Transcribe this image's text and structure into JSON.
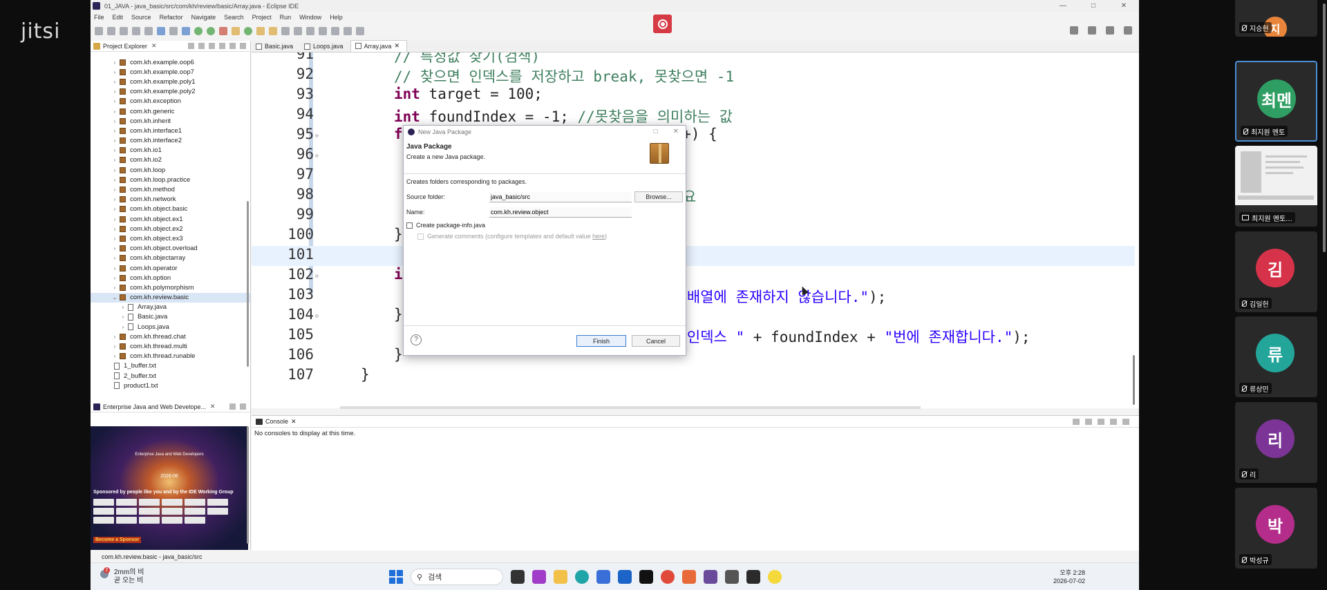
{
  "jitsi": {
    "logo": "jitsi"
  },
  "window": {
    "title": "01_JAVA - java_basic/src/com/kh/review/basic/Array.java - Eclipse IDE",
    "controls": [
      "—",
      "□",
      "✕"
    ]
  },
  "menu": [
    "File",
    "Edit",
    "Source",
    "Refactor",
    "Navigate",
    "Search",
    "Project",
    "Run",
    "Window",
    "Help"
  ],
  "explorer": {
    "tab_label": "Project Explorer",
    "items": [
      {
        "label": "com.kh.example.oop6",
        "kind": "pkg",
        "arrow": "›"
      },
      {
        "label": "com.kh.example.oop7",
        "kind": "pkg",
        "arrow": "›"
      },
      {
        "label": "com.kh.example.poly1",
        "kind": "pkg",
        "arrow": "›"
      },
      {
        "label": "com.kh.example.poly2",
        "kind": "pkg",
        "arrow": "›"
      },
      {
        "label": "com.kh.exception",
        "kind": "pkg",
        "arrow": "›"
      },
      {
        "label": "com.kh.generic",
        "kind": "pkg",
        "arrow": "›"
      },
      {
        "label": "com.kh.inherit",
        "kind": "pkg",
        "arrow": "›"
      },
      {
        "label": "com.kh.interface1",
        "kind": "pkg",
        "arrow": "›"
      },
      {
        "label": "com.kh.interface2",
        "kind": "pkg",
        "arrow": "›"
      },
      {
        "label": "com.kh.io1",
        "kind": "pkg",
        "arrow": "›"
      },
      {
        "label": "com.kh.io2",
        "kind": "pkg",
        "arrow": "›"
      },
      {
        "label": "com.kh.loop",
        "kind": "pkg",
        "arrow": "›"
      },
      {
        "label": "com.kh.loop.practice",
        "kind": "pkg",
        "arrow": "›"
      },
      {
        "label": "com.kh.method",
        "kind": "pkg",
        "arrow": "›"
      },
      {
        "label": "com.kh.network",
        "kind": "pkg",
        "arrow": "›"
      },
      {
        "label": "com.kh.object.basic",
        "kind": "pkg",
        "arrow": "›"
      },
      {
        "label": "com.kh.object.ex1",
        "kind": "pkg",
        "arrow": "›"
      },
      {
        "label": "com.kh.object.ex2",
        "kind": "pkg",
        "arrow": "›"
      },
      {
        "label": "com.kh.object.ex3",
        "kind": "pkg",
        "arrow": "›"
      },
      {
        "label": "com.kh.object.overload",
        "kind": "pkg",
        "arrow": "›"
      },
      {
        "label": "com.kh.objectarray",
        "kind": "pkg",
        "arrow": "›"
      },
      {
        "label": "com.kh.operator",
        "kind": "pkg",
        "arrow": "›"
      },
      {
        "label": "com.kh.option",
        "kind": "pkg",
        "arrow": "›"
      },
      {
        "label": "com.kh.polymorphism",
        "kind": "pkg",
        "arrow": "›"
      },
      {
        "label": "com.kh.review.basic",
        "kind": "pkg",
        "arrow": "⌄",
        "selected": true
      },
      {
        "label": "Array.java",
        "kind": "file",
        "arrow": "›",
        "indent": 1
      },
      {
        "label": "Basic.java",
        "kind": "file",
        "arrow": "›",
        "indent": 1
      },
      {
        "label": "Loops.java",
        "kind": "file",
        "arrow": "›",
        "indent": 1
      },
      {
        "label": "com.kh.thread.chat",
        "kind": "pkg",
        "arrow": "›"
      },
      {
        "label": "com.kh.thread.multi",
        "kind": "pkg",
        "arrow": "›"
      },
      {
        "label": "com.kh.thread.runable",
        "kind": "pkg",
        "arrow": "›"
      },
      {
        "label": "1_buffer.txt",
        "kind": "file",
        "arrow": "",
        "top": true
      },
      {
        "label": "2_buffer.txt",
        "kind": "file",
        "arrow": "",
        "top": true
      },
      {
        "label": "product1.txt",
        "kind": "file",
        "arrow": "",
        "top": true
      }
    ]
  },
  "enterprise": {
    "tab_label": "Enterprise Java and Web Develope...",
    "banner_title": "Enterprise Java and Web Developers",
    "banner_year": "2026-06",
    "sponsored": "Sponsored by people like you and by the IDE Working Group",
    "become": "Become a Sponsor"
  },
  "editor": {
    "tabs": [
      {
        "label": "Basic.java",
        "active": false
      },
      {
        "label": "Loops.java",
        "active": false
      },
      {
        "label": "Array.java",
        "active": true,
        "close": "✕"
      }
    ],
    "lines": [
      {
        "n": "91",
        "fold": "",
        "indent": 96,
        "segs": [
          {
            "c": "cm",
            "t": "// 특정값 찾기(검색)"
          }
        ]
      },
      {
        "n": "92",
        "fold": "",
        "indent": 96,
        "segs": [
          {
            "c": "cm",
            "t": "// 찾으면 인덱스를 저장하고 break, 못찾으면 -1"
          }
        ]
      },
      {
        "n": "93",
        "fold": "",
        "indent": 96,
        "segs": [
          {
            "c": "kw",
            "t": "int"
          },
          {
            "c": "",
            "t": " target = 100;"
          }
        ]
      },
      {
        "n": "94",
        "fold": "",
        "indent": 96,
        "segs": [
          {
            "c": "kw",
            "t": "int"
          },
          {
            "c": "",
            "t": " foundIndex = -1; "
          },
          {
            "c": "cm",
            "t": "//못찾음을 의미하는 값"
          }
        ]
      },
      {
        "n": "95",
        "fold": "⊖",
        "indent": 96,
        "segs": [
          {
            "c": "kw",
            "t": "fo"
          },
          {
            "c": "",
            "t": "                             i++) {"
          }
        ]
      },
      {
        "n": "96",
        "fold": "⊖",
        "indent": 96,
        "segs": []
      },
      {
        "n": "97",
        "fold": "",
        "indent": 96,
        "segs": []
      },
      {
        "n": "98",
        "fold": "",
        "indent": 96,
        "segs": [
          {
            "c": "cm",
            "t": "                              불필요"
          }
        ]
      },
      {
        "n": "99",
        "fold": "",
        "indent": 96,
        "segs": []
      },
      {
        "n": "100",
        "fold": "",
        "indent": 96,
        "segs": [
          {
            "c": "",
            "t": "}"
          }
        ]
      },
      {
        "n": "101",
        "fold": "",
        "indent": 96,
        "segs": [],
        "current": true
      },
      {
        "n": "102",
        "fold": "⊖",
        "indent": 96,
        "segs": [
          {
            "c": "kw",
            "t": "if"
          }
        ]
      },
      {
        "n": "103",
        "fold": "",
        "indent": 96,
        "segs": [
          {
            "c": "",
            "t": "                              "
          },
          {
            "c": "st",
            "t": "\"은 배열에 존재하지 않습니다.\""
          },
          {
            "c": "",
            "t": ");"
          }
        ]
      },
      {
        "n": "104",
        "fold": "⊖",
        "indent": 96,
        "segs": [
          {
            "c": "",
            "t": "} e"
          }
        ]
      },
      {
        "n": "105",
        "fold": "",
        "indent": 96,
        "segs": [
          {
            "c": "",
            "t": "                              "
          },
          {
            "c": "st",
            "t": "\"은 인덱스 \""
          },
          {
            "c": "",
            "t": " + foundIndex + "
          },
          {
            "c": "st",
            "t": "\"번에 존재합니다.\""
          },
          {
            "c": "",
            "t": ");"
          }
        ]
      },
      {
        "n": "106",
        "fold": "",
        "indent": 96,
        "segs": [
          {
            "c": "",
            "t": "}"
          }
        ]
      },
      {
        "n": "107",
        "fold": "",
        "indent": 48,
        "segs": [
          {
            "c": "",
            "t": "}"
          }
        ]
      }
    ]
  },
  "console": {
    "tab_label": "Console",
    "message": "No consoles to display at this time."
  },
  "status": {
    "text": "com.kh.review.basic - java_basic/src"
  },
  "dialog": {
    "window_title": "New Java Package",
    "header_title": "Java Package",
    "header_desc": "Create a new Java package.",
    "desc": "Creates folders corresponding to packages.",
    "source_folder_label": "Source folder:",
    "source_folder_value": "java_basic/src",
    "browse_label": "Browse...",
    "name_label": "Name:",
    "name_value": "com.kh.review.object",
    "create_info_label": "Create package-info.java",
    "generate_label": "Generate comments (configure templates and default value ",
    "generate_link": "here",
    "generate_suffix": ")",
    "help_label": "?",
    "finish_label": "Finish",
    "cancel_label": "Cancel"
  },
  "taskbar": {
    "weather_badge": "2",
    "weather_line1": "2mm의 비",
    "weather_line2": "곧 오는 비",
    "search_label": "검색",
    "time": "오후 2:28",
    "date": "2026-07-02"
  },
  "participants": [
    {
      "initial": "지",
      "name": "지승헌",
      "color": "#e8853a",
      "partial": true
    },
    {
      "initial": "최멘",
      "name": "최지원 멘토",
      "color": "#2f9e63",
      "active": true
    },
    {
      "initial": "",
      "name": "최지원 멘토...",
      "screen": true
    },
    {
      "initial": "김",
      "name": "김일헌",
      "color": "#d6334a"
    },
    {
      "initial": "류",
      "name": "류상민",
      "color": "#23a59a"
    },
    {
      "initial": "리",
      "name": "리",
      "color": "#7c3596"
    },
    {
      "initial": "박",
      "name": "박성규",
      "color": "#b52d8b"
    }
  ]
}
